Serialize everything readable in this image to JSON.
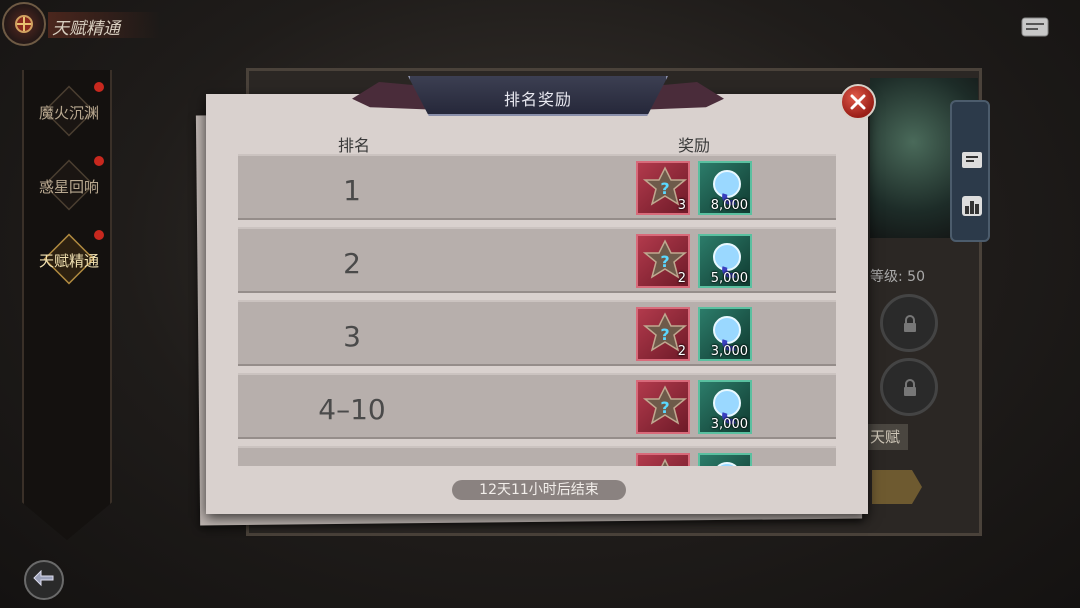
{
  "header": {
    "title": "天赋精通"
  },
  "sidebar": {
    "items": [
      {
        "label": "魔火沉渊",
        "active": false,
        "has_dot": true
      },
      {
        "label": "惑星回响",
        "active": false,
        "has_dot": true
      },
      {
        "label": "天赋精通",
        "active": true,
        "has_dot": true
      }
    ]
  },
  "background": {
    "level_text": "等级: 50",
    "talent_button": "天赋"
  },
  "modal": {
    "title": "排名奖励",
    "col_rank": "排名",
    "col_reward": "奖励",
    "rows": [
      {
        "rank": "1",
        "box_count": "3",
        "orb_count": "8,000"
      },
      {
        "rank": "2",
        "box_count": "2",
        "orb_count": "5,000"
      },
      {
        "rank": "3",
        "box_count": "2",
        "orb_count": "3,000"
      },
      {
        "rank": "4–10",
        "box_count": "",
        "orb_count": "3,000"
      },
      {
        "rank": "",
        "box_count": "",
        "orb_count": ""
      }
    ],
    "timer": "12天11小时后结束"
  },
  "colors": {
    "accent_red": "#c8281e",
    "reward_red": "#b23a4c",
    "reward_teal": "#2c7c6a",
    "paper": "#d9d1ce"
  },
  "icons": [
    "emblem-icon",
    "mail-icon",
    "back-arrow-icon",
    "close-icon",
    "mystery-star-icon",
    "soul-orb-icon",
    "lock-icon",
    "scroll-icon",
    "ranking-icon"
  ]
}
